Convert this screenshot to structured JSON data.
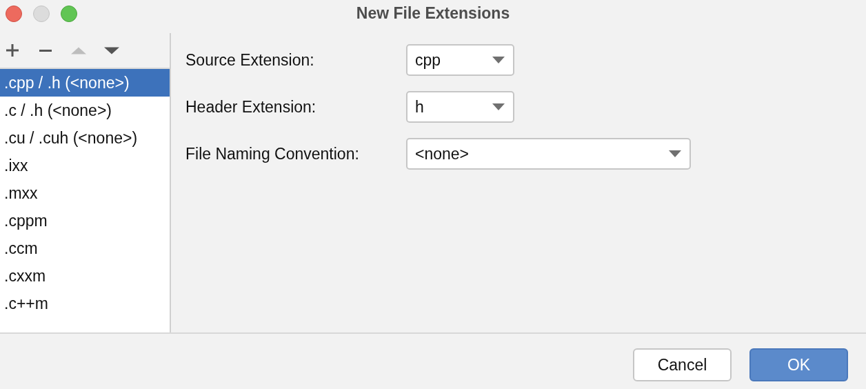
{
  "window": {
    "title": "New File Extensions"
  },
  "toolbar": [
    {
      "kind": "add",
      "disabled": false
    },
    {
      "kind": "remove",
      "disabled": false
    },
    {
      "kind": "up",
      "disabled": true
    },
    {
      "kind": "down",
      "disabled": false
    }
  ],
  "extensions": [
    {
      "label": ".cpp / .h (<none>)",
      "selected": true
    },
    {
      "label": ".c / .h (<none>)",
      "selected": false
    },
    {
      "label": ".cu / .cuh (<none>)",
      "selected": false
    },
    {
      "label": ".ixx",
      "selected": false
    },
    {
      "label": ".mxx",
      "selected": false
    },
    {
      "label": ".cppm",
      "selected": false
    },
    {
      "label": ".ccm",
      "selected": false
    },
    {
      "label": ".cxxm",
      "selected": false
    },
    {
      "label": ".c++m",
      "selected": false
    }
  ],
  "fields": [
    {
      "label": "Source Extension:",
      "value": "cpp"
    },
    {
      "label": "Header Extension:",
      "value": "h"
    },
    {
      "label": "File Naming Convention:",
      "value": "<none>"
    }
  ],
  "buttons": [
    {
      "label": "Cancel",
      "kind": "secondary"
    },
    {
      "label": "OK",
      "kind": "primary"
    }
  ]
}
